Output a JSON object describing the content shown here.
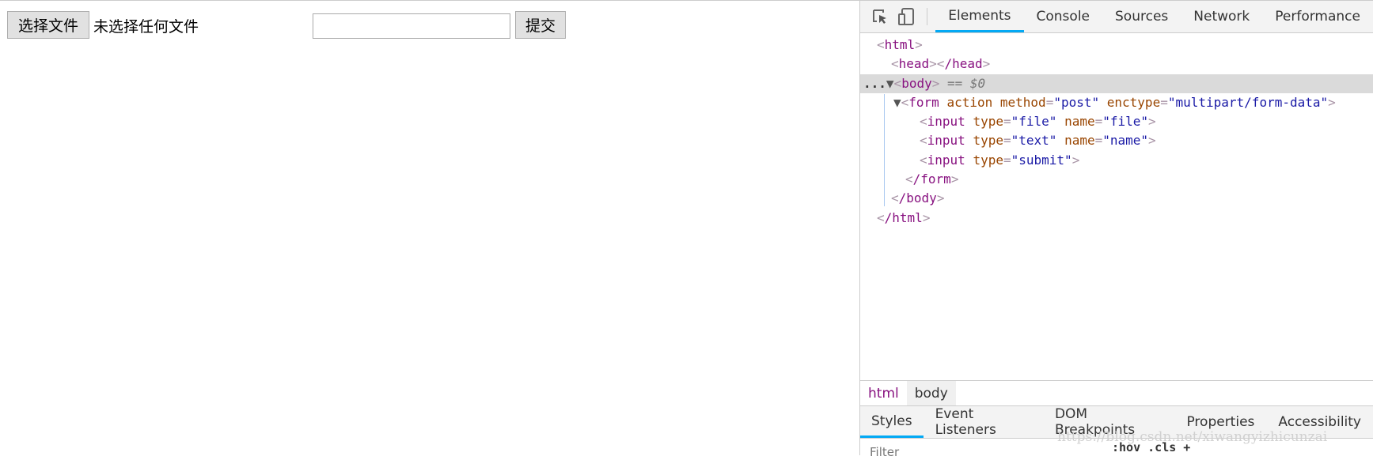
{
  "page": {
    "choose_file": "选择文件",
    "no_file": "未选择任何文件",
    "text_value": "",
    "submit": "提交"
  },
  "devtools": {
    "icons": [
      "inspect-element-icon",
      "device-toolbar-icon"
    ],
    "tabs": [
      "Elements",
      "Console",
      "Sources",
      "Network",
      "Performance"
    ],
    "active_tab": "Elements",
    "tree": {
      "l1": "html",
      "l2": "head",
      "l2c": "/head",
      "l3": "body",
      "l3s": " == $0",
      "form_tag": "form",
      "form_a1": "action",
      "form_a2": "method",
      "form_v2": "\"post\"",
      "form_a3": "enctype",
      "form_v3": "\"multipart/form-data\"",
      "input": "input",
      "type": "type",
      "name": "name",
      "v_file": "\"file\"",
      "v_text": "\"text\"",
      "v_name": "\"name\"",
      "v_submit": "\"submit\"",
      "cform": "/form",
      "cbody": "/body",
      "chtml": "/html",
      "dots": "...",
      "eq": "="
    },
    "breadcrumbs": [
      "html",
      "body"
    ],
    "sub_tabs": [
      "Styles",
      "Event Listeners",
      "DOM Breakpoints",
      "Properties",
      "Accessibility"
    ],
    "filter_placeholder": "Filter",
    "filter_opts": ":hov  .cls  +",
    "watermark": "https://blog.csdn.net/xiwangyizhicunzai",
    "accent": "#03a9f4"
  }
}
